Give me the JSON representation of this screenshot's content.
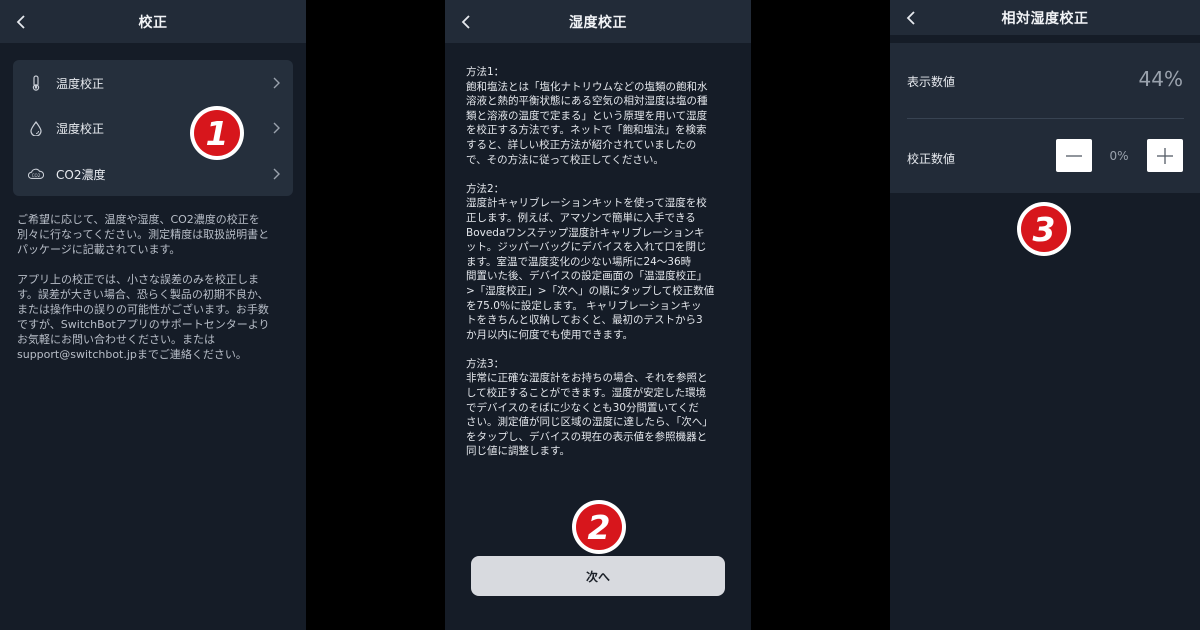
{
  "panel1": {
    "title": "校正",
    "rows": [
      {
        "label": "温度校正",
        "icon": "thermometer-icon"
      },
      {
        "label": "湿度校正",
        "icon": "water-drop-icon"
      },
      {
        "label": "CO2濃度",
        "icon": "co2-cloud-icon"
      }
    ],
    "note1": "ご希望に応じて、温度や湿度、CO2濃度の校正を\n別々に行なってください。測定精度は取扱説明書と\nパッケージに記載されています。",
    "note2": "アプリ上の校正では、小さな誤差のみを校正しま\nす。誤差が大きい場合、恐らく製品の初期不良か、\nまたは操作中の誤りの可能性がございます。お手数\nですが、SwitchBotアプリのサポートセンターより\nお気軽にお問い合わせください。または\nsupport@switchbot.jpまでご連絡ください。"
  },
  "panel2": {
    "title": "湿度校正",
    "method1": "方法1：\n飽和塩法とは「塩化ナトリウムなどの塩類の飽和水\n溶液と熱的平衡状態にある空気の相対湿度は塩の種\n類と溶液の温度で定まる」という原理を用いて湿度\nを校正する方法です。ネットで「飽和塩法」を検索\nすると、詳しい校正方法が紹介されていましたの\nで、その方法に従って校正してください。",
    "method2": "方法2：\n湿度計キャリブレーションキットを使って湿度を校\n正します。例えば、アマゾンで簡単に入手できる\nBovedaワンステップ湿度計キャリブレーションキ\nット。ジッパーバッグにデバイスを入れて口を閉じ\nます。室温で温度変化の少ない場所に24～36時\n間置いた後、デバイスの設定画面の「温湿度校正」\n>「湿度校正」>「次へ」の順にタップして校正数値\nを75.0％に設定します。 キャリブレーションキッ\nトをきちんと収納しておくと、最初のテストから3\nか月以内に何度でも使用できます。",
    "method3": "方法3：\n非常に正確な湿度計をお持ちの場合、それを参照と\nして校正することができます。湿度が安定した環境\nでデバイスのそばに少なくとも30分間置いてくだ\nさい。測定値が同じ区域の湿度に達したら、「次へ」\nをタップし、デバイスの現在の表示値を参照機器と\n同じ値に調整します。",
    "next_label": "次へ"
  },
  "panel3": {
    "title": "相対湿度校正",
    "display_label": "表示数値",
    "display_value": "44%",
    "calib_label": "校正数値",
    "calib_value": "0%"
  },
  "badges": [
    "1",
    "2",
    "3"
  ],
  "colors": {
    "panel_bg": "#151c27",
    "header_bg": "#222b38",
    "card_bg": "#252f3c",
    "badge_red": "#d7161c",
    "button_bg": "#d8dadf"
  }
}
